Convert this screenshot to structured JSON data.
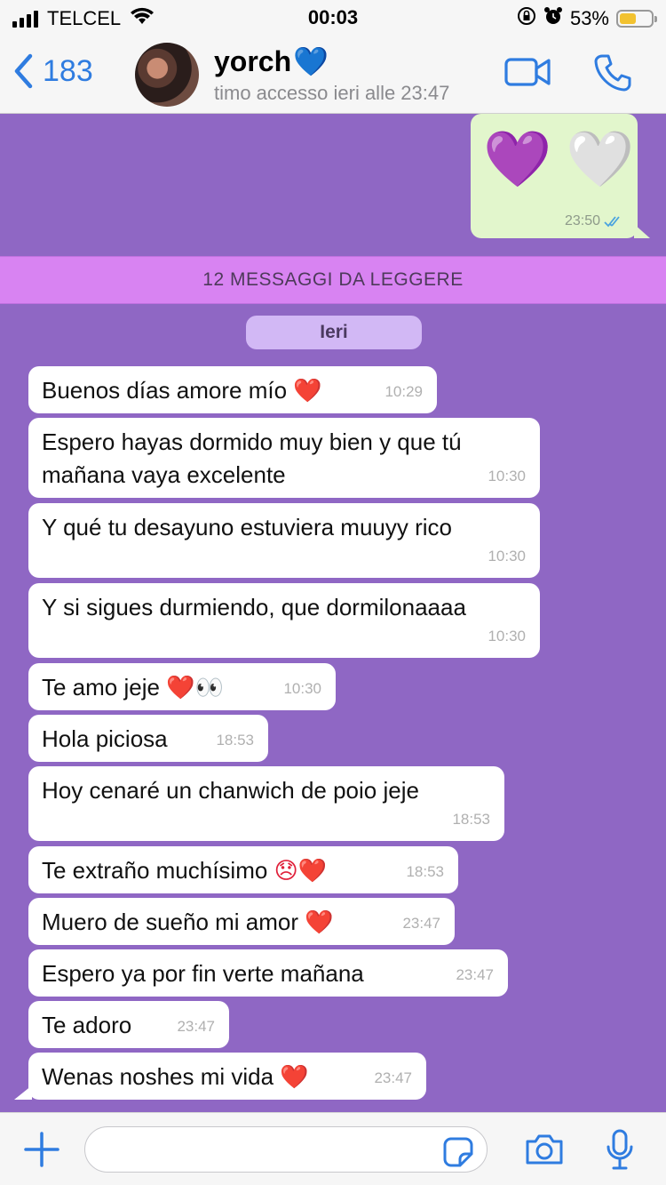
{
  "status": {
    "carrier": "TELCEL",
    "time": "00:03",
    "battery": "53%",
    "battery_level": 0.53
  },
  "header": {
    "back_count": "183",
    "name": "yorch",
    "name_emoji": "💙",
    "subtitle": "timo accesso ieri alle 23:47"
  },
  "sent_message": {
    "emoji_left": "💜",
    "emoji_right": "🤍",
    "time": "23:50"
  },
  "unread_banner": "12 MESSAGGI DA LEGGERE",
  "date_separator": "Ieri",
  "messages": [
    {
      "text": "Buenos días amore mío ",
      "emoji": "❤️",
      "time": "10:29"
    },
    {
      "text": "Espero hayas dormido muy bien y que tú mañana vaya excelente",
      "emoji": "",
      "time": "10:30"
    },
    {
      "text": "Y qué tu desayuno estuviera muuyy rico",
      "emoji": "",
      "time": "10:30"
    },
    {
      "text": "Y si sigues durmiendo, que dormilonaaaa",
      "emoji": "",
      "time": "10:30"
    },
    {
      "text": "Te amo jeje ",
      "emoji": "❤️👀",
      "time": "10:30"
    },
    {
      "text": "Hola piciosa",
      "emoji": "",
      "time": "18:53"
    },
    {
      "text": "Hoy cenaré un chanwich de poio jeje",
      "emoji": "",
      "time": "18:53"
    },
    {
      "text": "Te extraño muchísimo ",
      "emoji": "😞❤️",
      "time": "18:53"
    },
    {
      "text": "Muero de sueño mi amor ",
      "emoji": "❤️",
      "time": "23:47"
    },
    {
      "text": "Espero ya por fin verte mañana",
      "emoji": "",
      "time": "23:47"
    },
    {
      "text": "Te adoro",
      "emoji": "",
      "time": "23:47"
    },
    {
      "text": "Wenas noshes mi vida ",
      "emoji": "❤️",
      "time": "23:47"
    }
  ],
  "colors": {
    "accent": "#2f7ce0",
    "chat_bg": "#8f67c4",
    "sent_bubble": "#e2f6cc",
    "unread_banner": "#d883f2"
  }
}
